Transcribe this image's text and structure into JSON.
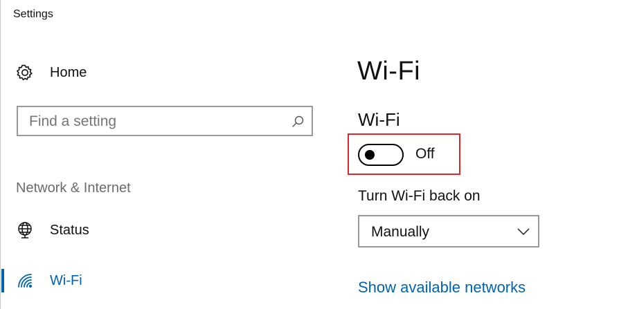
{
  "window": {
    "title": "Settings"
  },
  "sidebar": {
    "home": {
      "label": "Home",
      "icon": "gear-icon"
    },
    "search": {
      "placeholder": "Find a setting",
      "value": "",
      "icon": "search-icon"
    },
    "section": "Network & Internet",
    "items": [
      {
        "label": "Status",
        "icon": "globe-icon",
        "selected": false
      },
      {
        "label": "Wi-Fi",
        "icon": "wifi-icon",
        "selected": true
      }
    ]
  },
  "main": {
    "title": "Wi-Fi",
    "wifi": {
      "label": "Wi-Fi",
      "state": "Off",
      "on": false
    },
    "turn_back_on": {
      "label": "Turn Wi-Fi back on",
      "value": "Manually"
    },
    "show_networks_link": "Show available networks"
  },
  "colors": {
    "accent": "#0063b1",
    "highlight": "#e0252b",
    "muted": "#6b6b6b",
    "border": "#999999"
  }
}
